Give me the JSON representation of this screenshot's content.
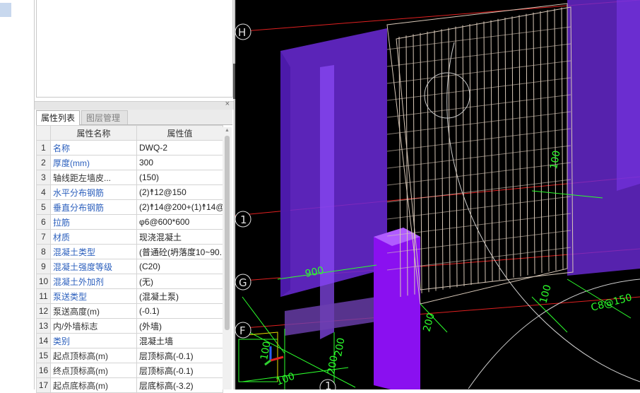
{
  "properties": {
    "tabs": [
      {
        "label": "属性列表",
        "active": true
      },
      {
        "label": "图层管理",
        "active": false
      }
    ],
    "headers": {
      "name": "属性名称",
      "value": "属性值"
    },
    "rows": [
      {
        "num": "1",
        "name": "名称",
        "value": "DWQ-2",
        "blue": true
      },
      {
        "num": "2",
        "name": "厚度(mm)",
        "value": "300",
        "blue": true
      },
      {
        "num": "3",
        "name": "轴线距左墙皮...",
        "value": "(150)",
        "blue": false
      },
      {
        "num": "4",
        "name": "水平分布钢筋",
        "value": "(2)☨12@150",
        "blue": true
      },
      {
        "num": "5",
        "name": "垂直分布钢筋",
        "value": "(2)☨14@200+(1)☨14@",
        "blue": true
      },
      {
        "num": "6",
        "name": "拉筋",
        "value": "φ6@600*600",
        "blue": true
      },
      {
        "num": "7",
        "name": "材质",
        "value": "现浇混凝土",
        "blue": true
      },
      {
        "num": "8",
        "name": "混凝土类型",
        "value": "(普通砼(坍落度10~90...",
        "blue": true
      },
      {
        "num": "9",
        "name": "混凝土强度等级",
        "value": "(C20)",
        "blue": true
      },
      {
        "num": "10",
        "name": "混凝土外加剂",
        "value": "(无)",
        "blue": true
      },
      {
        "num": "11",
        "name": "泵送类型",
        "value": "(混凝土泵)",
        "blue": true
      },
      {
        "num": "12",
        "name": "泵送高度(m)",
        "value": "(-0.1)",
        "blue": false
      },
      {
        "num": "13",
        "name": "内/外墙标志",
        "value": "(外墙)",
        "blue": false
      },
      {
        "num": "14",
        "name": "类别",
        "value": "混凝土墙",
        "blue": true
      },
      {
        "num": "15",
        "name": "起点顶标高(m)",
        "value": "层顶标高(-0.1)",
        "blue": false
      },
      {
        "num": "16",
        "name": "终点顶标高(m)",
        "value": "层顶标高(-0.1)",
        "blue": false
      },
      {
        "num": "17",
        "name": "起点底标高(m)",
        "value": "层底标高(-3.2)",
        "blue": false
      }
    ]
  },
  "viewport": {
    "axis_labels": [
      "H",
      "1",
      "G",
      "F",
      "1"
    ],
    "dimensions": [
      "900",
      "100",
      "200",
      "C8@150",
      "100",
      "200",
      "100",
      "200",
      "100"
    ],
    "colors": {
      "background": "#000000",
      "wall": "#7a2cf0",
      "rebar": "#d8c8b8",
      "dimension": "#2cff2c",
      "axis": "#ff3030"
    }
  }
}
